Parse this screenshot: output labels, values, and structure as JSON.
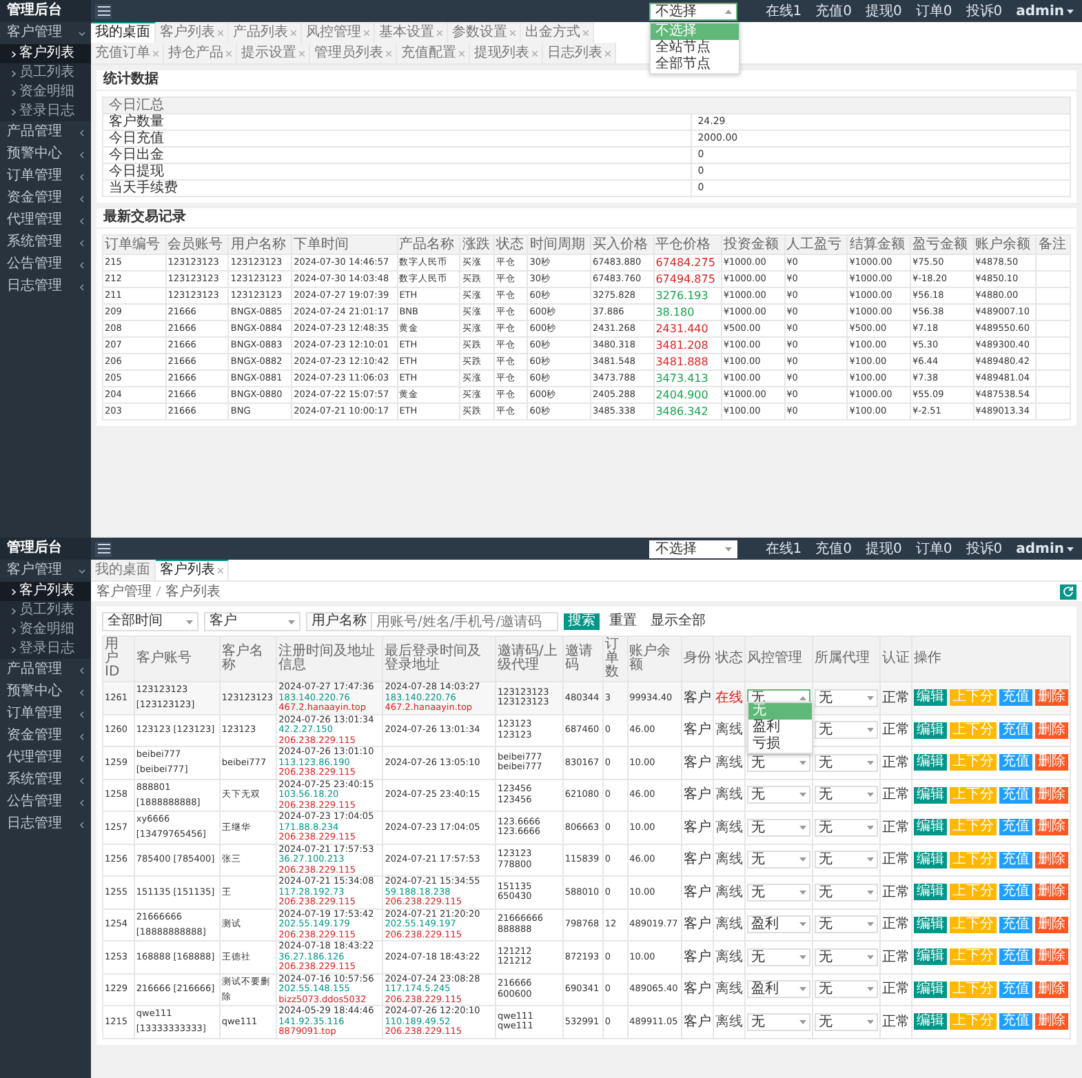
{
  "screens": [
    {
      "kind": "dashboard",
      "logo": "管理后台",
      "sidebar": [
        {
          "label": "客户管理",
          "expanded": true,
          "children": [
            {
              "label": "客户列表",
              "selected": true
            },
            {
              "label": "员工列表",
              "selected": false
            },
            {
              "label": "资金明细",
              "selected": false
            },
            {
              "label": "登录日志",
              "selected": false
            }
          ]
        },
        {
          "label": "产品管理",
          "expanded": false
        },
        {
          "label": "预警中心",
          "expanded": false
        },
        {
          "label": "订单管理",
          "expanded": false
        },
        {
          "label": "资金管理",
          "expanded": false
        },
        {
          "label": "代理管理",
          "expanded": false
        },
        {
          "label": "系统管理",
          "expanded": false
        },
        {
          "label": "公告管理",
          "expanded": false
        },
        {
          "label": "日志管理",
          "expanded": false
        }
      ],
      "node_select": {
        "value": "不选择",
        "open": true,
        "options": [
          {
            "label": "不选择",
            "selected": true
          },
          {
            "label": "全站节点",
            "selected": false
          },
          {
            "label": "全部节点",
            "selected": false
          }
        ]
      },
      "counters": [
        "在线1",
        "充值0",
        "提现0",
        "订单0",
        "投诉0"
      ],
      "user": "admin",
      "tabs": [
        {
          "label": "我的桌面",
          "selected": true
        },
        {
          "label": "客户列表",
          "selected": false
        },
        {
          "label": "产品列表",
          "selected": false
        },
        {
          "label": "风控管理",
          "selected": false
        },
        {
          "label": "基本设置",
          "selected": false
        },
        {
          "label": "参数设置",
          "selected": false
        },
        {
          "label": "出金方式",
          "selected": false
        },
        {
          "label": "充值订单",
          "selected": false
        },
        {
          "label": "持仓产品",
          "selected": false
        },
        {
          "label": "提示设置",
          "selected": false
        },
        {
          "label": "管理员列表",
          "selected": false
        },
        {
          "label": "充值配置",
          "selected": false
        },
        {
          "label": "提现列表",
          "selected": false
        },
        {
          "label": "日志列表",
          "selected": false
        }
      ],
      "stats": {
        "title": "统计数据",
        "heading": "今日汇总",
        "rows": [
          [
            "客户数量",
            "24.29"
          ],
          [
            "今日充值",
            "2000.00"
          ],
          [
            "今日出金",
            "0"
          ],
          [
            "今日提现",
            "0"
          ],
          [
            "当天手续费",
            "0"
          ]
        ]
      },
      "trades": {
        "title": "最新交易记录",
        "columns": [
          "订单编号",
          "会员账号",
          "用户名称",
          "下单时间",
          "产品名称",
          "涨跌",
          "状态",
          "时间周期",
          "买入价格",
          "平仓价格",
          "投资金额",
          "人工盈亏",
          "结算金额",
          "盈亏金额",
          "账户余额",
          "备注"
        ],
        "rows": [
          {
            "cells": [
              "215",
              "123123123",
              "123123123",
              "2024-07-30 14:46:57",
              "数字人民币",
              "买涨",
              "平仓",
              "30秒",
              "67483.880"
            ],
            "close": "67484.275",
            "color": "#e02020",
            "tail": [
              "¥1000.00",
              "¥0",
              "¥1000.00",
              "¥75.50",
              "¥4878.50"
            ]
          },
          {
            "cells": [
              "212",
              "123123123",
              "123123123",
              "2024-07-30 14:03:48",
              "数字人民币",
              "买跌",
              "平仓",
              "30秒",
              "67483.760"
            ],
            "close": "67494.875",
            "color": "#e02020",
            "tail": [
              "¥1000.00",
              "¥0",
              "¥1000.00",
              "¥-18.20",
              "¥4850.10"
            ]
          },
          {
            "cells": [
              "211",
              "123123123",
              "123123123",
              "2024-07-27 19:07:39",
              "ETH",
              "买涨",
              "平仓",
              "60秒",
              "3275.828"
            ],
            "close": "3276.193",
            "color": "#16a34a",
            "tail": [
              "¥1000.00",
              "¥0",
              "¥1000.00",
              "¥56.18",
              "¥4880.00"
            ]
          },
          {
            "cells": [
              "209",
              "21666",
              "BNGX-0885",
              "2024-07-24 21:01:17",
              "BNB",
              "买涨",
              "平仓",
              "600秒",
              "37.886"
            ],
            "close": "38.180",
            "color": "#16a34a",
            "tail": [
              "¥1000.00",
              "¥0",
              "¥1000.00",
              "¥56.38",
              "¥489007.10"
            ]
          },
          {
            "cells": [
              "208",
              "21666",
              "BNGX-0884",
              "2024-07-23 12:48:35",
              "黄金",
              "买涨",
              "平仓",
              "600秒",
              "2431.268"
            ],
            "close": "2431.440",
            "color": "#e02020",
            "tail": [
              "¥500.00",
              "¥0",
              "¥500.00",
              "¥7.18",
              "¥489550.60"
            ]
          },
          {
            "cells": [
              "207",
              "21666",
              "BNGX-0883",
              "2024-07-23 12:10:01",
              "ETH",
              "买跌",
              "平仓",
              "60秒",
              "3480.318"
            ],
            "close": "3481.208",
            "color": "#e02020",
            "tail": [
              "¥100.00",
              "¥0",
              "¥100.00",
              "¥5.30",
              "¥489300.40"
            ]
          },
          {
            "cells": [
              "206",
              "21666",
              "BNGX-0882",
              "2024-07-23 12:10:42",
              "ETH",
              "买跌",
              "平仓",
              "60秒",
              "3481.548"
            ],
            "close": "3481.888",
            "color": "#e02020",
            "tail": [
              "¥100.00",
              "¥0",
              "¥100.00",
              "¥6.44",
              "¥489480.42"
            ]
          },
          {
            "cells": [
              "205",
              "21666",
              "BNGX-0881",
              "2024-07-23 11:06:03",
              "ETH",
              "买涨",
              "平仓",
              "60秒",
              "3473.788"
            ],
            "close": "3473.413",
            "color": "#16a34a",
            "tail": [
              "¥100.00",
              "¥0",
              "¥100.00",
              "¥7.38",
              "¥489481.04"
            ]
          },
          {
            "cells": [
              "204",
              "21666",
              "BNGX-0880",
              "2024-07-22 15:07:57",
              "黄金",
              "买涨",
              "平仓",
              "600秒",
              "2405.288"
            ],
            "close": "2404.900",
            "color": "#16a34a",
            "tail": [
              "¥1000.00",
              "¥0",
              "¥1000.00",
              "¥55.09",
              "¥487538.54"
            ]
          },
          {
            "cells": [
              "203",
              "21666",
              "BNG",
              "2024-07-21 10:00:17",
              "ETH",
              "买跌",
              "平仓",
              "60秒",
              "3485.338"
            ],
            "close": "3486.342",
            "color": "#16a34a",
            "tail": [
              "¥100.00",
              "¥0",
              "¥100.00",
              "¥-2.51",
              "¥489013.34"
            ]
          }
        ]
      }
    },
    {
      "kind": "customers",
      "logo": "管理后台",
      "sidebar": [
        {
          "label": "客户管理",
          "expanded": true,
          "children": [
            {
              "label": "客户列表",
              "selected": true
            },
            {
              "label": "员工列表",
              "selected": false
            },
            {
              "label": "资金明细",
              "selected": false
            },
            {
              "label": "登录日志",
              "selected": false
            }
          ]
        },
        {
          "label": "产品管理",
          "expanded": false
        },
        {
          "label": "预警中心",
          "expanded": false
        },
        {
          "label": "订单管理",
          "expanded": false
        },
        {
          "label": "资金管理",
          "expanded": false
        },
        {
          "label": "代理管理",
          "expanded": false
        },
        {
          "label": "系统管理",
          "expanded": false
        },
        {
          "label": "公告管理",
          "expanded": false
        },
        {
          "label": "日志管理",
          "expanded": false
        }
      ],
      "node_select": {
        "value": "不选择",
        "open": false
      },
      "counters": [
        "在线1",
        "充值0",
        "提现0",
        "订单0",
        "投诉0"
      ],
      "user": "admin",
      "tabs": [
        {
          "label": "我的桌面",
          "selected": false
        },
        {
          "label": "客户列表",
          "selected": true
        }
      ],
      "breadcrumb": [
        "客户管理",
        "客户列表"
      ],
      "filters": {
        "time": "全部时间",
        "role": "客户",
        "search_label": "用户名称",
        "placeholder": "用账号/姓名/手机号/邀请码",
        "search": "搜索",
        "reset": "重置",
        "all": "显示全部"
      },
      "customers": {
        "columns": [
          "用户ID",
          "客户账号",
          "客户名称",
          "注册时间及地址信息",
          "最后登录时间及登录地址",
          "邀请码/上级代理",
          "邀请码",
          "订单数",
          "账户余额",
          "身份",
          "状态",
          "风控管理",
          "所属代理",
          "认证",
          "操作"
        ],
        "rows": [
          {
            "id": "1261",
            "account": "123123123 [123123123]",
            "name": "123123123",
            "reg": [
              "2024-07-27 17:47:36",
              "183.140.220.76",
              "467.2.hanaayin.top"
            ],
            "login": [
              "2024-07-28 14:03:27",
              "183.140.220.76",
              "467.2.hanaayin.top"
            ],
            "inviter": [
              "123123123",
              "123123123"
            ],
            "code": "480344",
            "orders": "3",
            "balance": "99934.40",
            "role": "客户",
            "online": true,
            "status": "在线",
            "risk": "无",
            "risk_open": true,
            "risk_options": [
              {
                "label": "无",
                "selected": true
              },
              {
                "label": "盈利",
                "selected": false
              },
              {
                "label": "亏损",
                "selected": false
              }
            ],
            "agent": "无",
            "auth": "正常",
            "actions": [
              "编辑",
              "上下分",
              "充值",
              "删除"
            ]
          },
          {
            "id": "1260",
            "account": "123123 [123123]",
            "name": "123123",
            "reg": [
              "2024-07-26 13:01:34",
              "42.2.27.150",
              "206.238.229.115"
            ],
            "login": [
              "2024-07-26 13:01:34"
            ],
            "inviter": [
              "123123",
              "123123"
            ],
            "code": "687460",
            "orders": "0",
            "balance": "46.00",
            "role": "客户",
            "online": false,
            "status": "离线",
            "agent": "无",
            "auth": "正常",
            "actions": [
              "编辑",
              "上下分",
              "充值",
              "删除"
            ]
          },
          {
            "id": "1259",
            "account": "beibei777 [beibei777]",
            "name": "beibei777",
            "reg": [
              "2024-07-26 13:01:10",
              "113.123.86.190",
              "206.238.229.115"
            ],
            "login": [
              "2024-07-26 13:05:10"
            ],
            "inviter": [
              "beibei777",
              "beibei777"
            ],
            "code": "830167",
            "orders": "0",
            "balance": "10.00",
            "role": "客户",
            "online": false,
            "status": "离线",
            "risk": "无",
            "risk_open": false,
            "agent": "无",
            "auth": "正常",
            "actions": [
              "编辑",
              "上下分",
              "充值",
              "删除"
            ]
          },
          {
            "id": "1258",
            "account": "888801 [1888888888]",
            "name": "天下无双",
            "reg": [
              "2024-07-25 23:40:15",
              "103.56.18.20",
              "206.238.229.115"
            ],
            "login": [
              "2024-07-25 23:40:15"
            ],
            "inviter": [
              "123456",
              "123456"
            ],
            "code": "621080",
            "orders": "0",
            "balance": "46.00",
            "role": "客户",
            "online": false,
            "status": "离线",
            "risk": "无",
            "risk_open": false,
            "agent": "无",
            "auth": "正常",
            "actions": [
              "编辑",
              "上下分",
              "充值",
              "删除"
            ]
          },
          {
            "id": "1257",
            "account": "xy6666 [13479765456]",
            "name": "王继华",
            "reg": [
              "2024-07-23 17:04:05",
              "171.88.8.234",
              "206.238.229.115"
            ],
            "login": [
              "2024-07-23 17:04:05"
            ],
            "inviter": [
              "123.6666",
              "123.6666"
            ],
            "code": "806663",
            "orders": "0",
            "balance": "10.00",
            "role": "客户",
            "online": false,
            "status": "离线",
            "risk": "无",
            "risk_open": false,
            "agent": "无",
            "auth": "正常",
            "actions": [
              "编辑",
              "上下分",
              "充值",
              "删除"
            ]
          },
          {
            "id": "1256",
            "account": "785400 [785400]",
            "name": "张三",
            "reg": [
              "2024-07-21 17:57:53",
              "36.27.100.213",
              "206.238.229.115"
            ],
            "login": [
              "2024-07-21 17:57:53"
            ],
            "inviter": [
              "123123",
              "778800"
            ],
            "code": "115839",
            "orders": "0",
            "balance": "46.00",
            "role": "客户",
            "online": false,
            "status": "离线",
            "risk": "无",
            "risk_open": false,
            "agent": "无",
            "auth": "正常",
            "actions": [
              "编辑",
              "上下分",
              "充值",
              "删除"
            ]
          },
          {
            "id": "1255",
            "account": "151135 [151135]",
            "name": "王",
            "reg": [
              "2024-07-21 15:34:08",
              "117.28.192.73",
              "206.238.229.115"
            ],
            "login": [
              "2024-07-21 15:34:55",
              "59.188.18.238",
              "206.238.229.115"
            ],
            "inviter": [
              "151135",
              "650430"
            ],
            "code": "588010",
            "orders": "0",
            "balance": "10.00",
            "role": "客户",
            "online": false,
            "status": "离线",
            "risk": "无",
            "risk_open": false,
            "agent": "无",
            "auth": "正常",
            "actions": [
              "编辑",
              "上下分",
              "充值",
              "删除"
            ]
          },
          {
            "id": "1254",
            "account": "21666666 [18888888888]",
            "name": "测试",
            "reg": [
              "2024-07-19 17:53:42",
              "202.55.149.179",
              "206.238.229.115"
            ],
            "login": [
              "2024-07-21 21:20:20",
              "202.55.149.197",
              "206.238.229.115"
            ],
            "inviter": [
              "21666666",
              "888888"
            ],
            "code": "798768",
            "orders": "12",
            "balance": "489019.77",
            "role": "客户",
            "online": false,
            "status": "离线",
            "risk": "盈利",
            "risk_open": false,
            "agent": "无",
            "auth": "正常",
            "actions": [
              "编辑",
              "上下分",
              "充值",
              "删除"
            ]
          },
          {
            "id": "1253",
            "account": "168888 [168888]",
            "name": "王德社",
            "reg": [
              "2024-07-18 18:43:22",
              "36.27.186.126",
              "206.238.229.115"
            ],
            "login": [
              "2024-07-18 18:43:22"
            ],
            "inviter": [
              "121212",
              "121212"
            ],
            "code": "872193",
            "orders": "0",
            "balance": "10.00",
            "role": "客户",
            "online": false,
            "status": "离线",
            "risk": "无",
            "risk_open": false,
            "agent": "无",
            "auth": "正常",
            "actions": [
              "编辑",
              "上下分",
              "充值",
              "删除"
            ]
          },
          {
            "id": "1229",
            "account": "216666 [216666]",
            "name": "测试不要删除",
            "reg": [
              "2024-07-16 10:57:56",
              "202.55.148.155",
              "bizz5073.ddos5032"
            ],
            "login": [
              "2024-07-24 23:08:28",
              "117.174.5.245",
              "206.238.229.115"
            ],
            "inviter": [
              "216666",
              "600600"
            ],
            "code": "690341",
            "orders": "0",
            "balance": "489065.40",
            "role": "客户",
            "online": false,
            "status": "离线",
            "risk": "盈利",
            "risk_open": false,
            "agent": "无",
            "auth": "正常",
            "actions": [
              "编辑",
              "上下分",
              "充值",
              "删除"
            ]
          },
          {
            "id": "1215",
            "account": "qwe111 [13333333333]",
            "name": "qwe111",
            "reg": [
              "2024-05-29 18:44:46",
              "141.92.35.116",
              "8879091.top"
            ],
            "login": [
              "2024-07-26 12:20:10",
              "110.189.49.52",
              "206.238.229.115"
            ],
            "inviter": [
              "qwe111",
              "qwe111"
            ],
            "code": "532991",
            "orders": "0",
            "balance": "489911.05",
            "role": "客户",
            "online": false,
            "status": "离线",
            "risk": "无",
            "risk_open": false,
            "agent": "无",
            "auth": "正常",
            "actions": [
              "编辑",
              "上下分",
              "充值",
              "删除"
            ]
          }
        ]
      }
    }
  ]
}
